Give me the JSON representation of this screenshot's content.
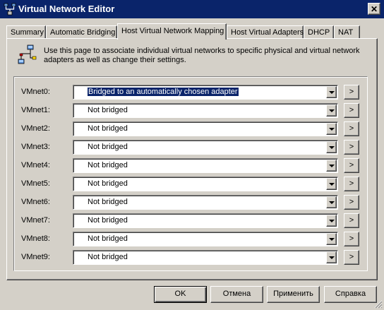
{
  "window": {
    "title": "Virtual Network Editor",
    "close_glyph": "✕"
  },
  "tabs": [
    {
      "label": "Summary",
      "active": false
    },
    {
      "label": "Automatic Bridging",
      "active": false
    },
    {
      "label": "Host Virtual Network Mapping",
      "active": true
    },
    {
      "label": "Host Virtual Adapters",
      "active": false
    },
    {
      "label": "DHCP",
      "active": false
    },
    {
      "label": "NAT",
      "active": false
    }
  ],
  "info": {
    "text": "Use this page to associate individual virtual networks to specific physical and virtual network adapters as well as change their settings.",
    "icon": "network-icon"
  },
  "mappings": [
    {
      "label": "VMnet0:",
      "value": "Bridged to an automatically chosen adapter",
      "selected": true
    },
    {
      "label": "VMnet1:",
      "value": "Not bridged",
      "selected": false
    },
    {
      "label": "VMnet2:",
      "value": "Not bridged",
      "selected": false
    },
    {
      "label": "VMnet3:",
      "value": "Not bridged",
      "selected": false
    },
    {
      "label": "VMnet4:",
      "value": "Not bridged",
      "selected": false
    },
    {
      "label": "VMnet5:",
      "value": "Not bridged",
      "selected": false
    },
    {
      "label": "VMnet6:",
      "value": "Not bridged",
      "selected": false
    },
    {
      "label": "VMnet7:",
      "value": "Not bridged",
      "selected": false
    },
    {
      "label": "VMnet8:",
      "value": "Not bridged",
      "selected": false
    },
    {
      "label": "VMnet9:",
      "value": "Not bridged",
      "selected": false
    }
  ],
  "more_button_label": ">",
  "buttons": {
    "ok": "OK",
    "cancel": "Отмена",
    "apply": "Применить",
    "help": "Справка"
  },
  "colors": {
    "titlebar": "#0a246a",
    "face": "#d4d0c8",
    "selection": "#0a246a"
  }
}
